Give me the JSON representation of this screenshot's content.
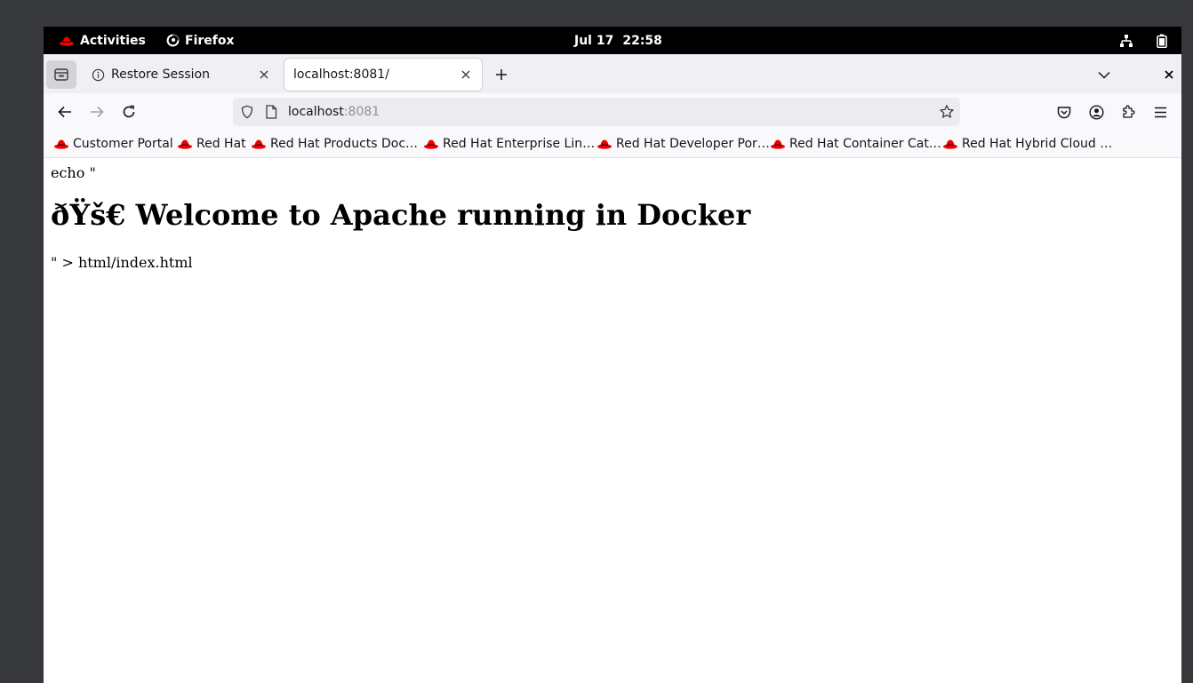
{
  "topbar": {
    "activities_label": "Activities",
    "app_label": "Firefox",
    "date": "Jul 17",
    "time": "22:58"
  },
  "tabs": [
    {
      "label": "Restore Session",
      "active": false
    },
    {
      "label": "localhost:8081/",
      "active": true
    }
  ],
  "navbar": {
    "url_host": "localhost",
    "url_port": ":8081"
  },
  "bookmarks": [
    {
      "label": "Customer Portal"
    },
    {
      "label": "Red Hat"
    },
    {
      "label": "Red Hat Products Doc…"
    },
    {
      "label": "Red Hat Enterprise Lin…"
    },
    {
      "label": "Red Hat Developer Por…"
    },
    {
      "label": "Red Hat Container Cat…"
    },
    {
      "label": "Red Hat Hybrid Cloud …"
    }
  ],
  "page": {
    "line1": "echo \"",
    "heading": "ðŸš€ Welcome to Apache running in Docker",
    "line2": "\" > html/index.html"
  },
  "colors": {
    "redhat_red": "#ee0000",
    "topbar_bg": "#000000",
    "desktop_bg": "#36383b",
    "tabbar_bg": "#f0f0f4"
  }
}
